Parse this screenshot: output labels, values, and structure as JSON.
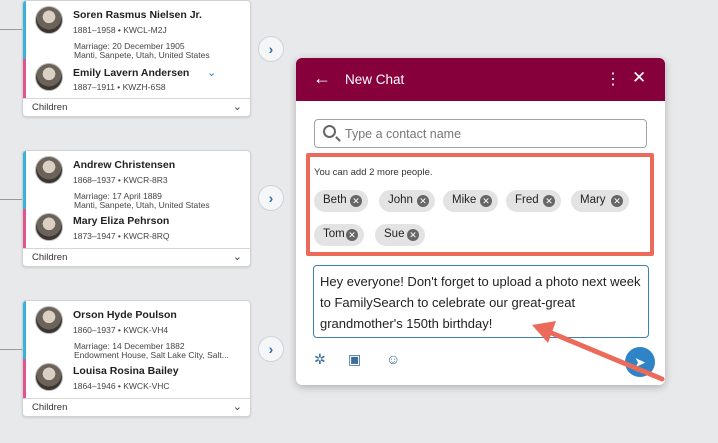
{
  "tree": {
    "couples": [
      {
        "husband": {
          "name": "Soren Rasmus Nielsen Jr.",
          "meta": "1881–1958 •  KWCL-M2J"
        },
        "marriage_date": "Marriage: 20 December 1905",
        "marriage_place": "Manti, Sanpete, Utah, United States",
        "wife": {
          "name": "Emily Lavern Andersen",
          "meta": "1887–1911 •  KWZH-6S8"
        },
        "children_label": "Children"
      },
      {
        "husband": {
          "name": "Andrew Christensen",
          "meta": "1868–1937 •  KWCR-8R3"
        },
        "marriage_date": "Marriage: 17 April 1889",
        "marriage_place": "Manti, Sanpete, Utah, United States",
        "wife": {
          "name": "Mary Eliza Pehrson",
          "meta": "1873–1947 •  KWCR-8RQ"
        },
        "children_label": "Children"
      },
      {
        "husband": {
          "name": "Orson Hyde Poulson",
          "meta": "1860–1937 •  KWCK-VH4"
        },
        "marriage_date": "Marriage: 14 December 1882",
        "marriage_place": "Endowment House, Salt Lake City, Salt...",
        "wife": {
          "name": "Louisa Rosina Bailey",
          "meta": "1864–1946 •  KWCK-VHC"
        },
        "children_label": "Children"
      }
    ]
  },
  "chat": {
    "title": "New Chat",
    "search_placeholder": "Type a contact name",
    "limit_note": "You can add 2 more people.",
    "recipients": [
      "Beth",
      "John",
      "Mike",
      "Fred",
      "Mary",
      "Tom",
      "Sue"
    ],
    "message": "Hey everyone! Don't forget to upload a photo next week to FamilySearch to celebrate our great-great grandmother's 150th birthday!"
  },
  "icons": {
    "back": "back-arrow-icon",
    "more": "more-options-icon",
    "close": "close-icon",
    "search": "search-icon",
    "chip_remove": "remove-chip-icon",
    "attach": "attachment-icon",
    "image": "image-icon",
    "emoji": "emoji-icon",
    "send": "send-icon",
    "expand": "chevron-right-icon"
  },
  "colors": {
    "chat_header": "#86003c",
    "male_stripe": "#3ab1d9",
    "female_stripe": "#e0558d",
    "annotation": "#ec6a5a",
    "send_button": "#2f84c6"
  }
}
